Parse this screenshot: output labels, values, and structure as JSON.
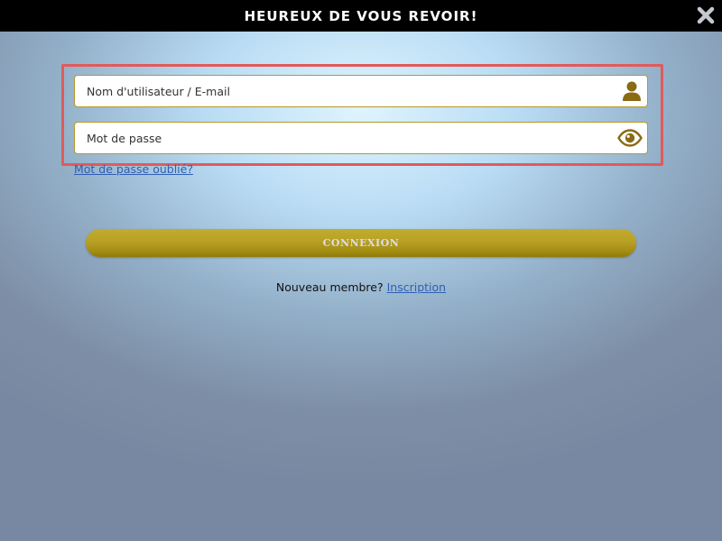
{
  "header": {
    "title": "HEUREUX DE VOUS REVOIR!"
  },
  "form": {
    "username_placeholder": "Nom d'utilisateur / E-mail",
    "username_value": "",
    "password_placeholder": "Mot de passe",
    "password_value": "",
    "forgot_password": "Mot de passe oublié?",
    "login_label": "CONNEXION",
    "signup_prompt": "Nouveau membre?",
    "signup_link": "Inscription"
  },
  "icons": {
    "close": "close-icon",
    "username": "user-icon",
    "password": "eye-icon"
  },
  "colors": {
    "titlebar": "#000000",
    "accent_gold": "#b8a024",
    "icon_gold": "#8a6a12",
    "link": "#2f5fb3",
    "highlight": "#e15a5a"
  }
}
